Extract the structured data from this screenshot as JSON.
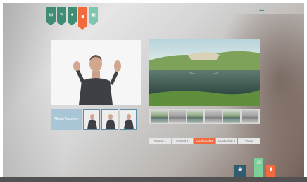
{
  "top_tabs": [
    {
      "icon": "grid-icon",
      "glyph": "⊞",
      "color": "green"
    },
    {
      "icon": "settings-icon",
      "glyph": "✎",
      "color": "green"
    },
    {
      "icon": "circle-icon",
      "glyph": "●",
      "color": "green"
    },
    {
      "icon": "folder-icon",
      "glyph": "■",
      "color": "orange"
    },
    {
      "icon": "image-icon",
      "glyph": "▣",
      "color": "mint"
    }
  ],
  "brand": "•••",
  "album": {
    "label": "Album Ansehen"
  },
  "filter_tabs": [
    "Portrait 1",
    "Portrait 2",
    "Landschaft 1",
    "Landschaft 2",
    "Video"
  ],
  "active_filter_index": 2,
  "bottom_bar": {
    "left": "",
    "right": ""
  },
  "bottom_buttons": [
    {
      "icon": "chat-icon",
      "glyph": "◉"
    },
    {
      "icon": "photo-icon",
      "glyph": "◎"
    },
    {
      "icon": "trash-icon",
      "glyph": "▮"
    }
  ],
  "colors": {
    "accent": "#f26a3d",
    "brand_green": "#3f8d74",
    "mint": "#7fc6b0",
    "teal": "#2f5c6e"
  }
}
